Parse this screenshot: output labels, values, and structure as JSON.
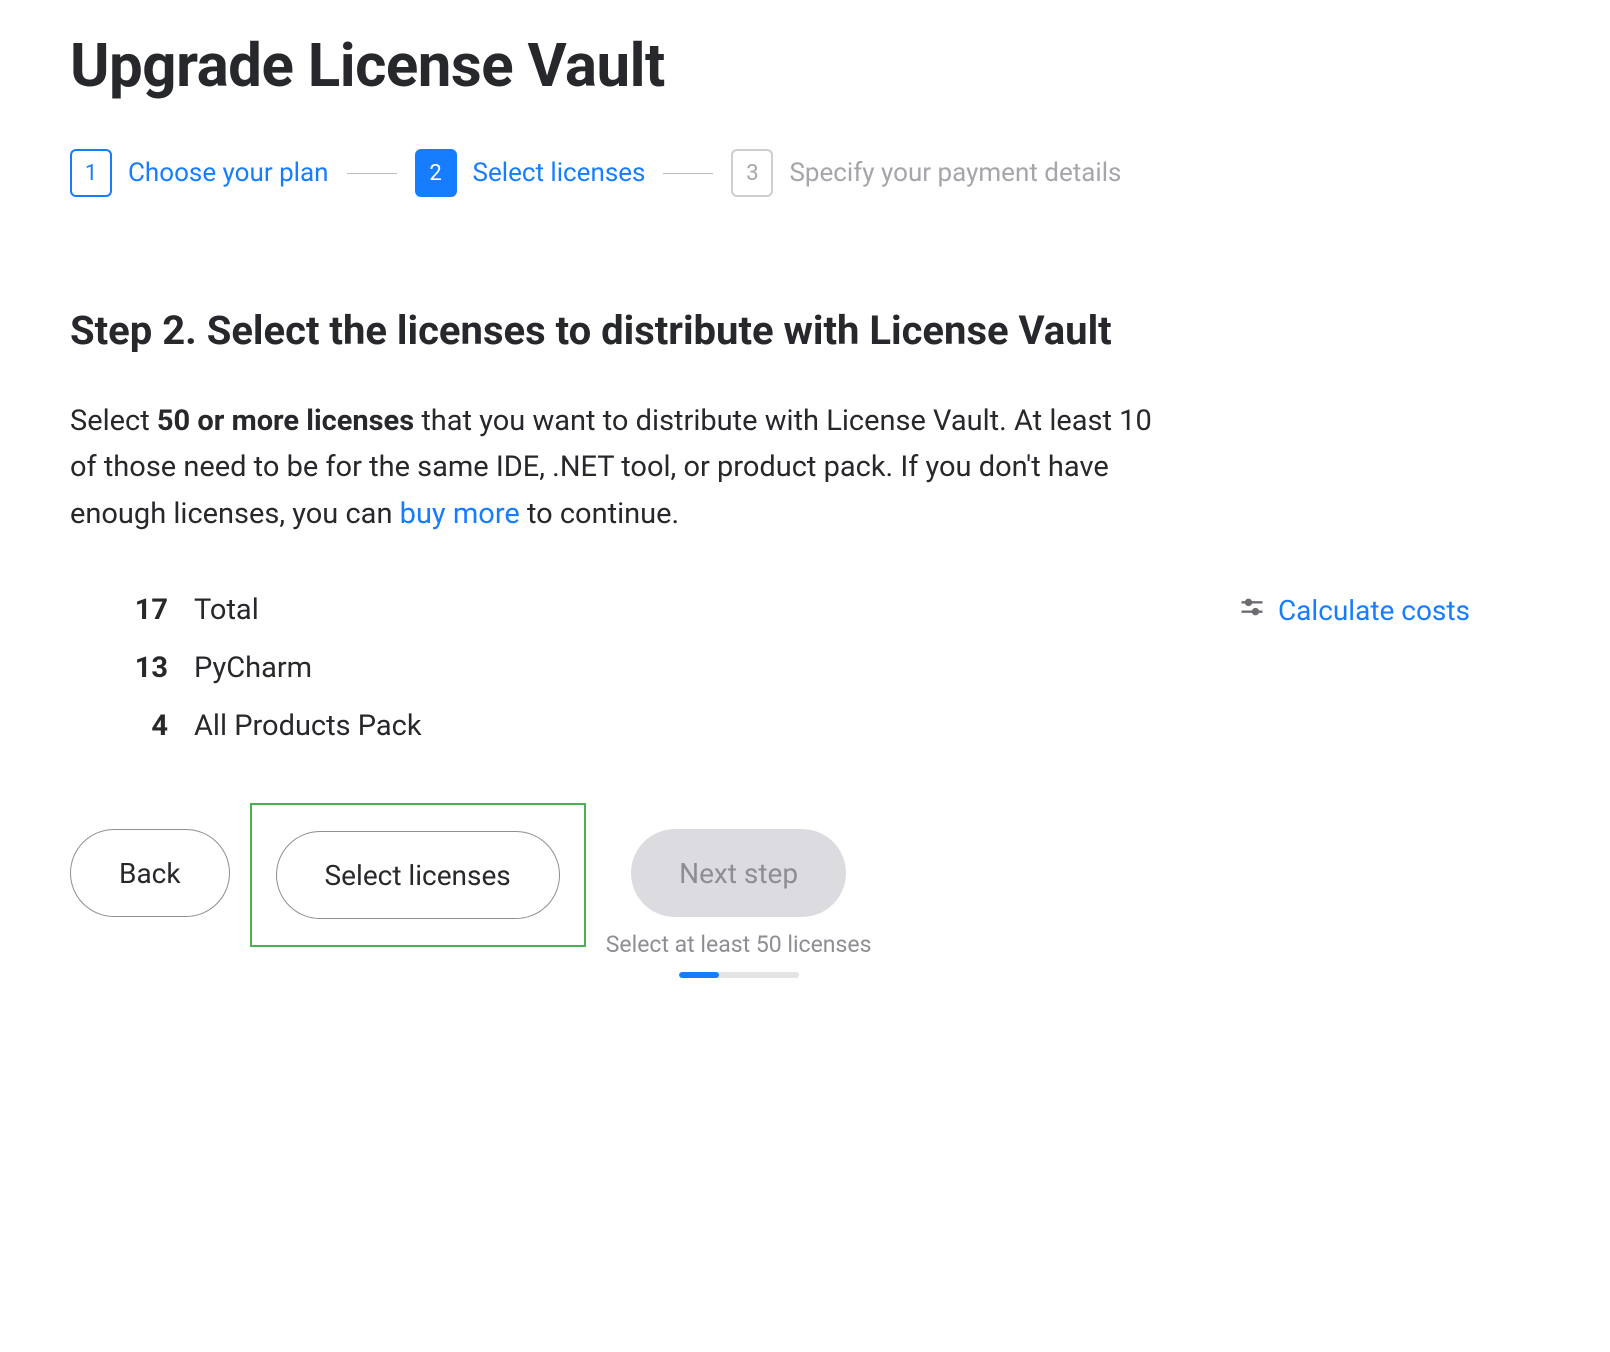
{
  "page_title": "Upgrade License Vault",
  "stepper": {
    "steps": [
      {
        "num": "1",
        "label": "Choose your plan",
        "state": "completed"
      },
      {
        "num": "2",
        "label": "Select licenses",
        "state": "active"
      },
      {
        "num": "3",
        "label": "Specify your payment details",
        "state": "upcoming"
      }
    ]
  },
  "step_heading": "Step 2. Select the licenses to distribute with License Vault",
  "description": {
    "pre": "Select ",
    "bold": "50 or more licenses",
    "mid": " that you want to distribute with License Vault. At least 10 of those need to be for the same IDE, .NET tool, or product pack. If you don't have enough licenses, you can ",
    "link": "buy more",
    "post": " to continue."
  },
  "licenses": {
    "total": {
      "num": "17",
      "label": "Total"
    },
    "items": [
      {
        "num": "13",
        "label": "PyCharm"
      },
      {
        "num": "4",
        "label": "All Products Pack"
      }
    ]
  },
  "calculate_costs_label": "Calculate costs",
  "buttons": {
    "back": "Back",
    "select_licenses": "Select licenses",
    "next_step": "Next step"
  },
  "hint": "Select at least 50 licenses",
  "progress_percent": 34,
  "colors": {
    "primary": "#167dff",
    "highlight": "#4caf50",
    "muted": "#8d8e93"
  }
}
